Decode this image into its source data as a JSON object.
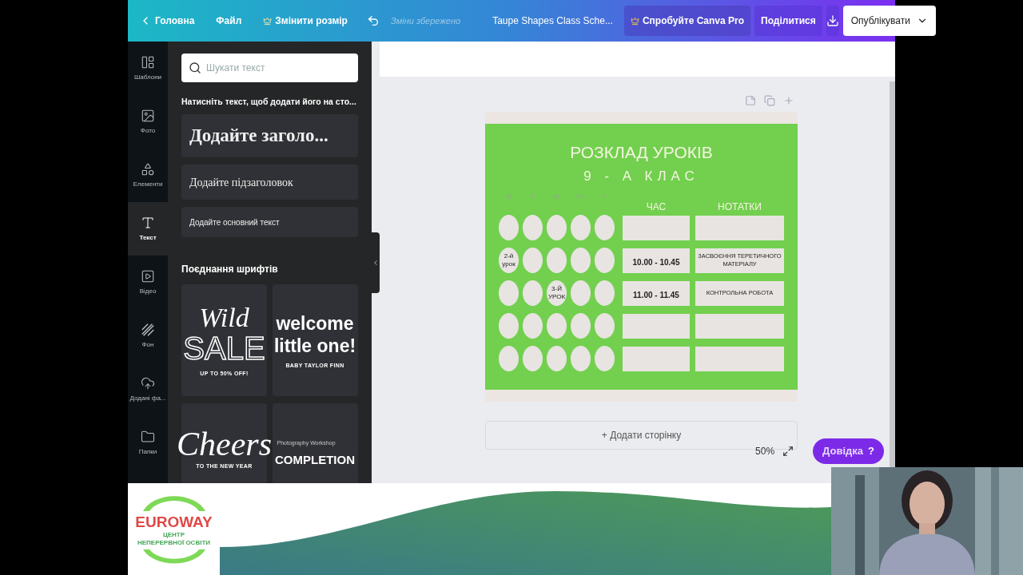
{
  "topbar": {
    "home": "Головна",
    "file": "Файл",
    "resize": "Змінити розмір",
    "saved_status": "Зміни збережено",
    "doc_title": "Taupe Shapes Class Sche...",
    "try_pro": "Спробуйте Canva Pro",
    "share": "Поділитися",
    "publish": "Опублікувати"
  },
  "sidebar": {
    "items": [
      {
        "kind": "templates",
        "label": "Шаблони",
        "selected": false
      },
      {
        "kind": "photos",
        "label": "Фото",
        "selected": false
      },
      {
        "kind": "elements",
        "label": "Елементи",
        "selected": false
      },
      {
        "kind": "text",
        "label": "Текст",
        "selected": true
      },
      {
        "kind": "video",
        "label": "Відео",
        "selected": false
      },
      {
        "kind": "background",
        "label": "Фон",
        "selected": false
      },
      {
        "kind": "uploads",
        "label": "Додані фа...",
        "selected": false
      },
      {
        "kind": "folders",
        "label": "Папки",
        "selected": false
      }
    ]
  },
  "panel": {
    "search": {
      "placeholder": "Шукати текст"
    },
    "hint": "Натисніть текст, щоб додати його на сто...",
    "text_styles": [
      {
        "kind": "heading",
        "label": "Додайте заголо..."
      },
      {
        "kind": "subheading",
        "label": "Додайте підзаголовок"
      },
      {
        "kind": "body",
        "label": "Додайте основний текст"
      }
    ],
    "combos_title": "Поєднання шрифтів",
    "combos": [
      {
        "kind": "outline",
        "lines": [
          "Wild",
          "SALE"
        ],
        "caption": "UP TO 50% OFF!"
      },
      {
        "kind": "bold",
        "lines": [
          "welcome",
          "little one!"
        ],
        "caption": "BABY TAYLOR FINN"
      },
      {
        "kind": "script",
        "lines": [
          "Cheers"
        ],
        "caption": "TO THE NEW YEAR"
      },
      {
        "kind": "caps",
        "overline": "Photography Workshop",
        "lines": [
          "COMPLETION"
        ]
      }
    ]
  },
  "design": {
    "title": "РОЗКЛАД УРОКІВ",
    "subtitle": "9 - А КЛАС",
    "days": [
      "M",
      "T",
      "W",
      "TH",
      "F"
    ],
    "columns": [
      "ЧАС",
      "НОТАТКИ"
    ],
    "rows": [
      {
        "circles": [
          {
            "kind": "blank"
          },
          {
            "kind": "blank"
          },
          {
            "kind": "blank"
          },
          {
            "kind": "blank"
          },
          {
            "kind": "blank"
          }
        ]
      },
      {
        "circles": [
          {
            "kind": "labeled",
            "label": "2-й урок"
          },
          {
            "kind": "blank"
          },
          {
            "kind": "blank"
          },
          {
            "kind": "blank"
          },
          {
            "kind": "blank"
          }
        ],
        "time": "10.00 - 10.45",
        "note": "ЗАСВОЄННЯ ТЕРЕТИЧНОГО МАТЕРІАЛУ"
      },
      {
        "circles": [
          {
            "kind": "blank"
          },
          {
            "kind": "blank"
          },
          {
            "kind": "labeled",
            "label": "3-Й УРОК"
          },
          {
            "kind": "blank"
          },
          {
            "kind": "blank"
          }
        ],
        "time": "11.00 - 11.45",
        "note": "КОНТРОЛЬНА РОБОТА"
      },
      {
        "circles": [
          {
            "kind": "blank"
          },
          {
            "kind": "blank"
          },
          {
            "kind": "blank"
          },
          {
            "kind": "blank"
          },
          {
            "kind": "blank"
          }
        ]
      },
      {
        "circles": [
          {
            "kind": "blank"
          },
          {
            "kind": "blank"
          },
          {
            "kind": "blank"
          },
          {
            "kind": "blank"
          },
          {
            "kind": "blank"
          }
        ]
      }
    ]
  },
  "add_page": "+ Додати сторінку",
  "zoom": "50%",
  "help": {
    "label": "Довідка",
    "mark": "?"
  },
  "logo": {
    "name": "EUROWAY",
    "tagline": [
      "ЦЕНТР",
      "НЕПЕРЕРВНОЇ ОСВІТИ"
    ]
  }
}
